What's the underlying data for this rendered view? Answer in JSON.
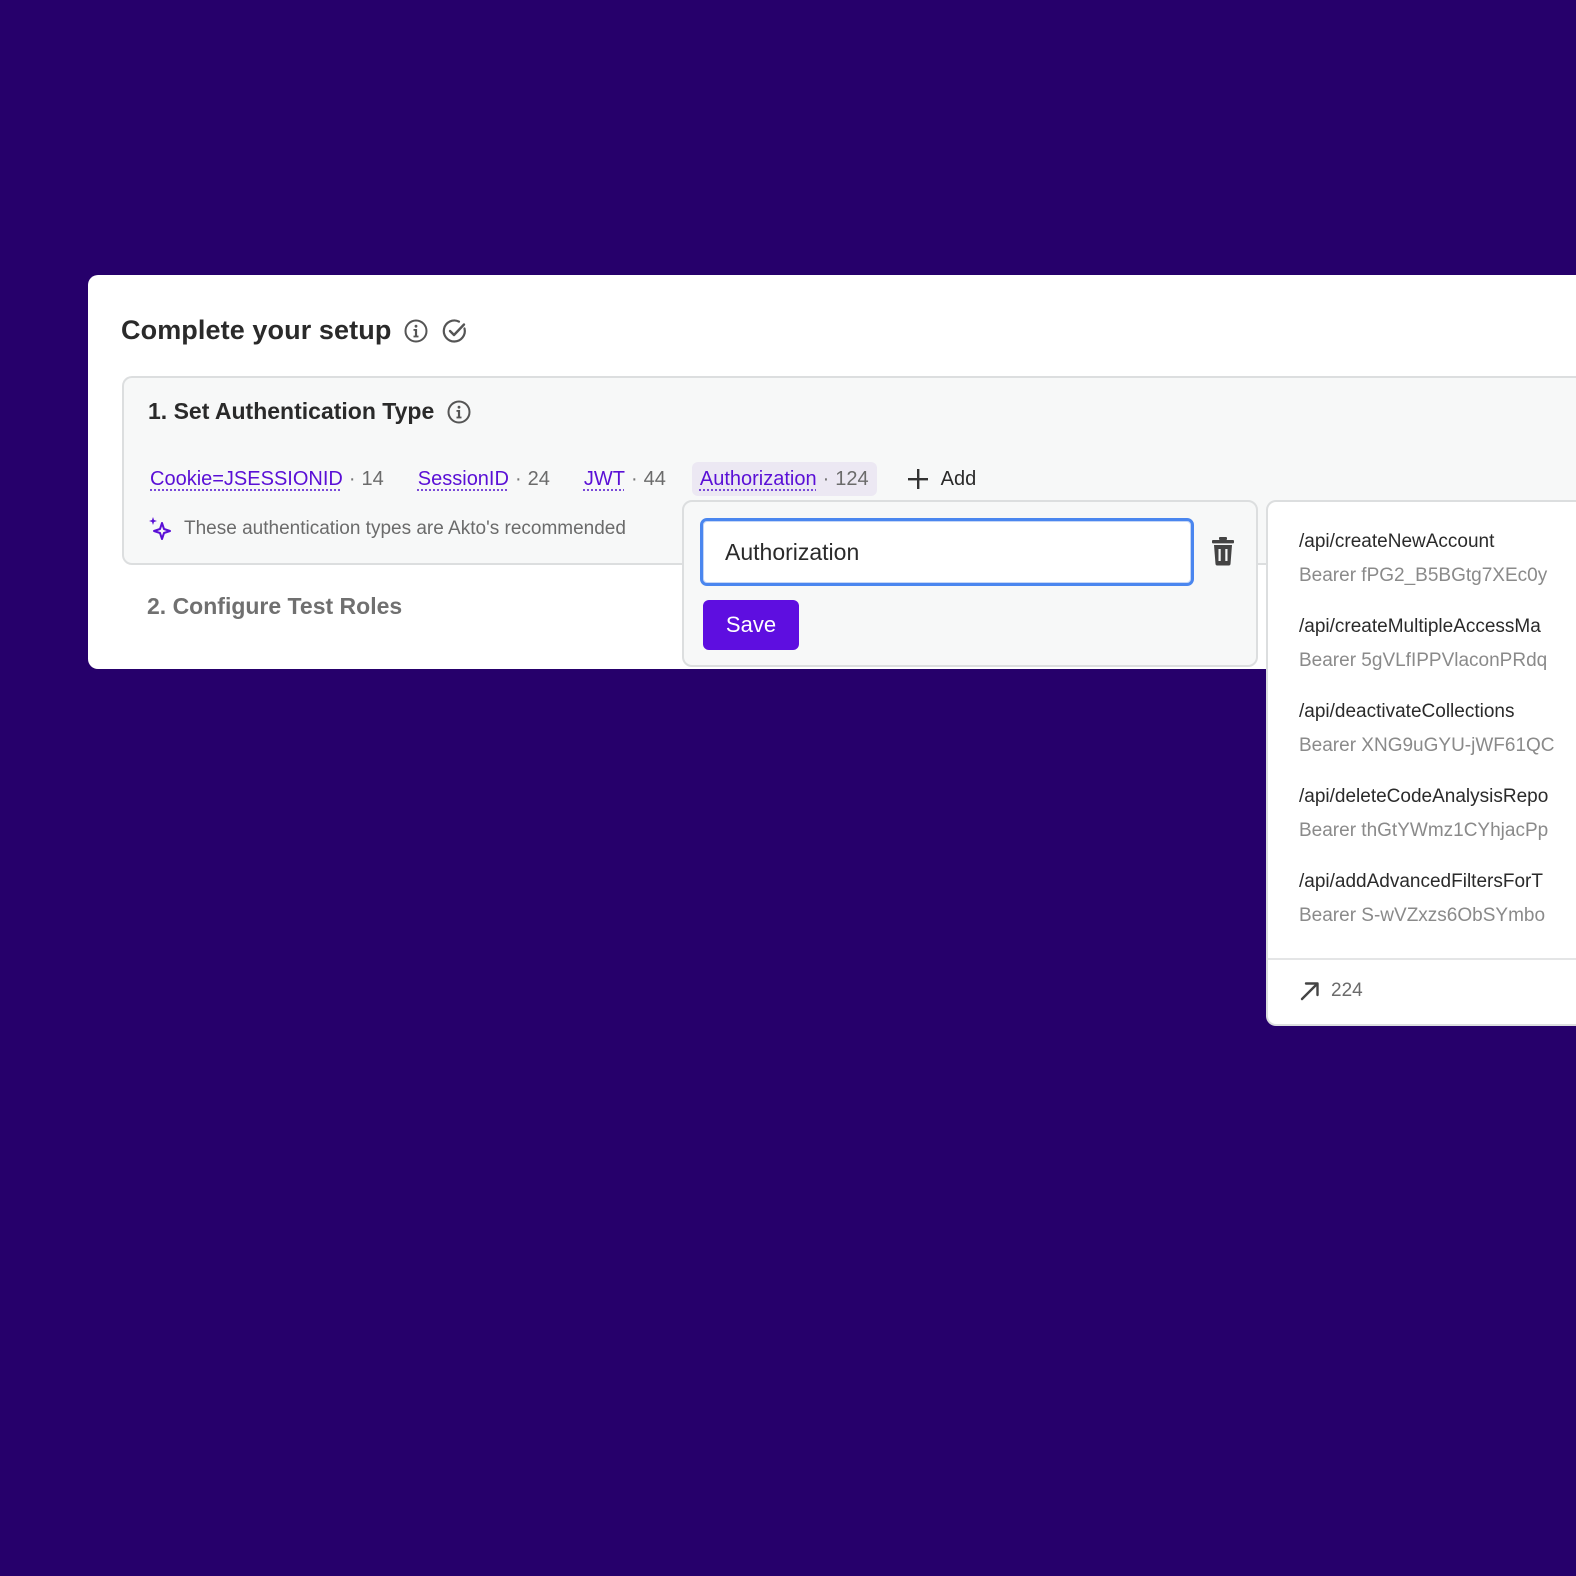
{
  "setup": {
    "title": "Complete your setup",
    "step1_title": "1. Set Authentication Type",
    "step2_title": "2. Configure Test Roles",
    "auth_types": [
      {
        "name": "Cookie=JSESSIONID",
        "count": "14"
      },
      {
        "name": "SessionID",
        "count": "24"
      },
      {
        "name": "JWT",
        "count": "44"
      },
      {
        "name": "Authorization",
        "count": "124"
      }
    ],
    "separator": "·",
    "add_label": "Add",
    "recommendation_text": "These authentication types are Akto's recommended"
  },
  "edit_popover": {
    "input_value": "Authorization",
    "save_label": "Save"
  },
  "endpoints_popover": {
    "items": [
      {
        "path": "/api/createNewAccount",
        "token": "Bearer fPG2_B5BGtg7XEc0y"
      },
      {
        "path": "/api/createMultipleAccessMa",
        "token": "Bearer 5gVLfIPPVlaconPRdq"
      },
      {
        "path": "/api/deactivateCollections",
        "token": "Bearer XNG9uGYU-jWF61QC"
      },
      {
        "path": "/api/deleteCodeAnalysisRepo",
        "token": "Bearer thGtYWmz1CYhjacPp"
      },
      {
        "path": "/api/addAdvancedFiltersForT",
        "token": "Bearer S-wVZxzs6ObSYmbo"
      }
    ],
    "footer_count": "224"
  },
  "colors": {
    "background": "#26006b",
    "accent": "#5e0ee0",
    "link": "#5a0fd6",
    "focus_ring": "#4a86ef"
  }
}
